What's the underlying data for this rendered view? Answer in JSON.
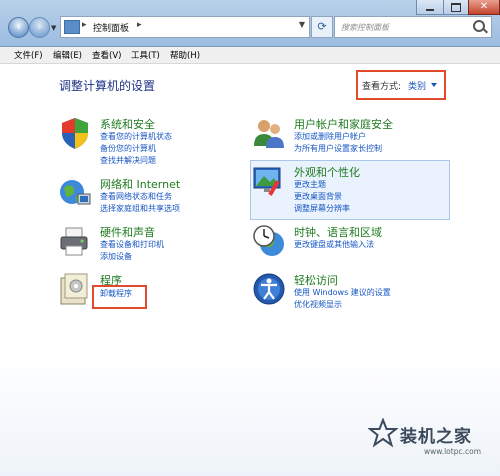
{
  "window": {
    "address": "控制面板",
    "search_placeholder": "搜索控制面板"
  },
  "menu": [
    "文件(F)",
    "编辑(E)",
    "查看(V)",
    "工具(T)",
    "帮助(H)"
  ],
  "header": {
    "title": "调整计算机的设置",
    "view_by_label": "查看方式:",
    "view_by_value": "类别"
  },
  "categories": [
    {
      "title": "系统和安全",
      "links": [
        "查看您的计算机状态",
        "备份您的计算机",
        "查找并解决问题"
      ]
    },
    {
      "title": "网络和 Internet",
      "links": [
        "查看网络状态和任务",
        "选择家庭组和共享选项"
      ]
    },
    {
      "title": "硬件和声音",
      "links": [
        "查看设备和打印机",
        "添加设备"
      ]
    },
    {
      "title": "程序",
      "links": [
        "卸载程序"
      ]
    },
    {
      "title": "用户帐户和家庭安全",
      "links": [
        "添加或删除用户帐户",
        "为所有用户设置家长控制"
      ]
    },
    {
      "title": "外观和个性化",
      "links": [
        "更改主题",
        "更改桌面背景",
        "调整屏幕分辨率"
      ]
    },
    {
      "title": "时钟、语言和区域",
      "links": [
        "更改键盘或其他输入法"
      ]
    },
    {
      "title": "轻松访问",
      "links": [
        "使用 Windows 建议的设置",
        "优化视频显示"
      ]
    }
  ],
  "watermark": {
    "name": "装机之家",
    "url": "www.lotpc.com"
  },
  "colors": {
    "accent_red": "#e14b2c",
    "link_blue": "#1655c4",
    "category_green": "#1e7a1e",
    "title_blue": "#1e3287"
  }
}
